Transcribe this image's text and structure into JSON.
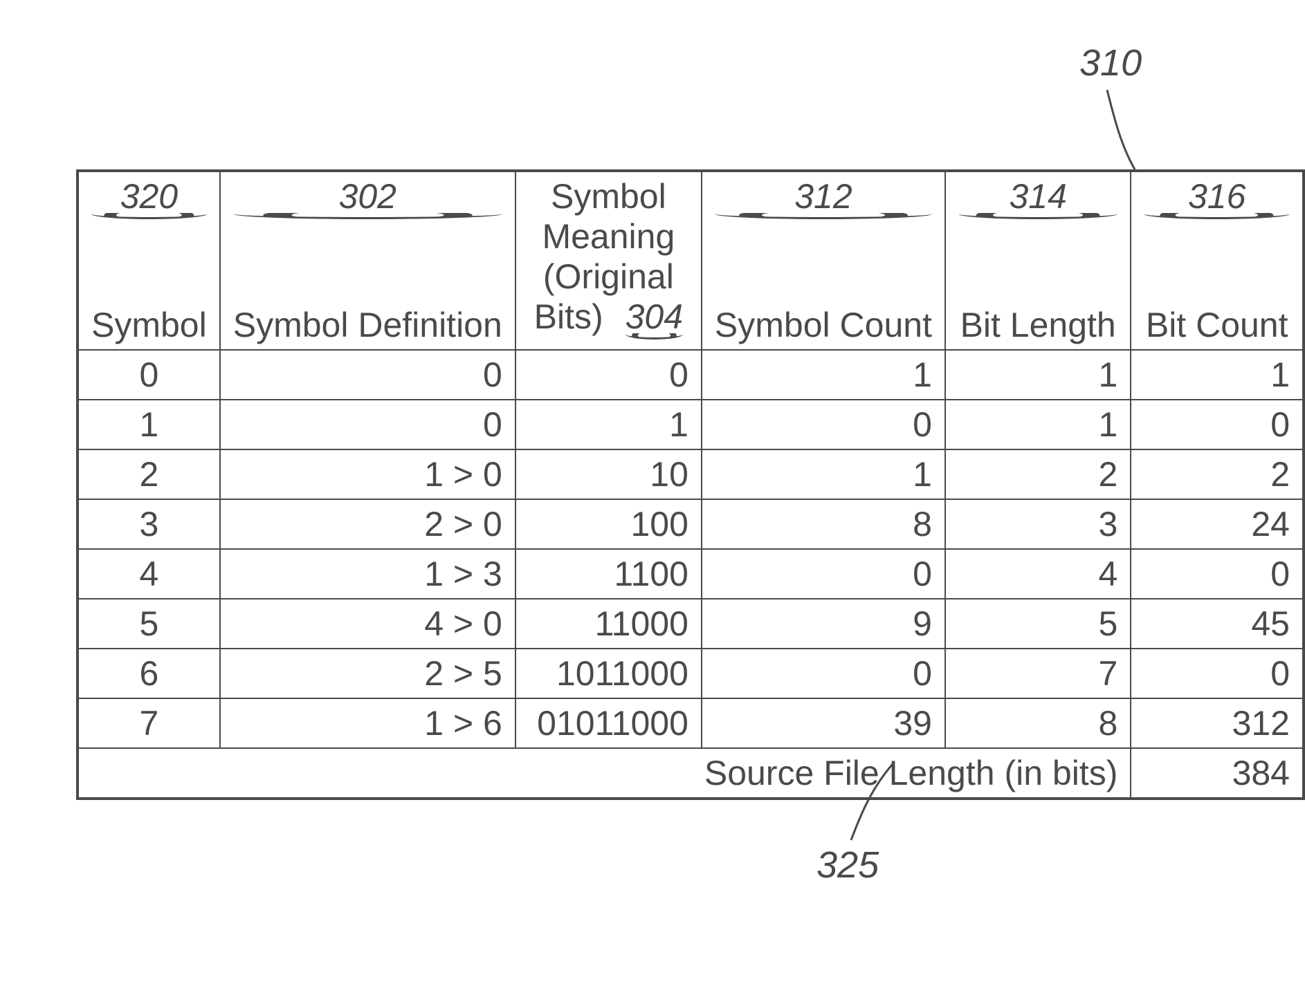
{
  "callouts": {
    "table_ref": "310",
    "footer_ref": "325"
  },
  "columns": [
    {
      "ref": "320",
      "label": "Symbol"
    },
    {
      "ref": "302",
      "label": "Symbol Definition"
    },
    {
      "ref": "304",
      "label_line1": "Symbol",
      "label_line2": "Meaning",
      "label_line3": "(Original",
      "label_line4": "Bits)"
    },
    {
      "ref": "312",
      "label": "Symbol Count"
    },
    {
      "ref": "314",
      "label": "Bit Length"
    },
    {
      "ref": "316",
      "label": "Bit Count"
    }
  ],
  "rows": [
    {
      "symbol": "0",
      "definition": "0",
      "meaning": "0",
      "count": "1",
      "bitlen": "1",
      "bitcount": "1"
    },
    {
      "symbol": "1",
      "definition": "0",
      "meaning": "1",
      "count": "0",
      "bitlen": "1",
      "bitcount": "0"
    },
    {
      "symbol": "2",
      "definition": "1 > 0",
      "meaning": "10",
      "count": "1",
      "bitlen": "2",
      "bitcount": "2"
    },
    {
      "symbol": "3",
      "definition": "2 > 0",
      "meaning": "100",
      "count": "8",
      "bitlen": "3",
      "bitcount": "24"
    },
    {
      "symbol": "4",
      "definition": "1 > 3",
      "meaning": "1100",
      "count": "0",
      "bitlen": "4",
      "bitcount": "0"
    },
    {
      "symbol": "5",
      "definition": "4 > 0",
      "meaning": "11000",
      "count": "9",
      "bitlen": "5",
      "bitcount": "45"
    },
    {
      "symbol": "6",
      "definition": "2 > 5",
      "meaning": "1011000",
      "count": "0",
      "bitlen": "7",
      "bitcount": "0"
    },
    {
      "symbol": "7",
      "definition": "1 > 6",
      "meaning": "01011000",
      "count": "39",
      "bitlen": "8",
      "bitcount": "312"
    }
  ],
  "footer": {
    "label": "Source File Length (in bits)",
    "value": "384"
  }
}
